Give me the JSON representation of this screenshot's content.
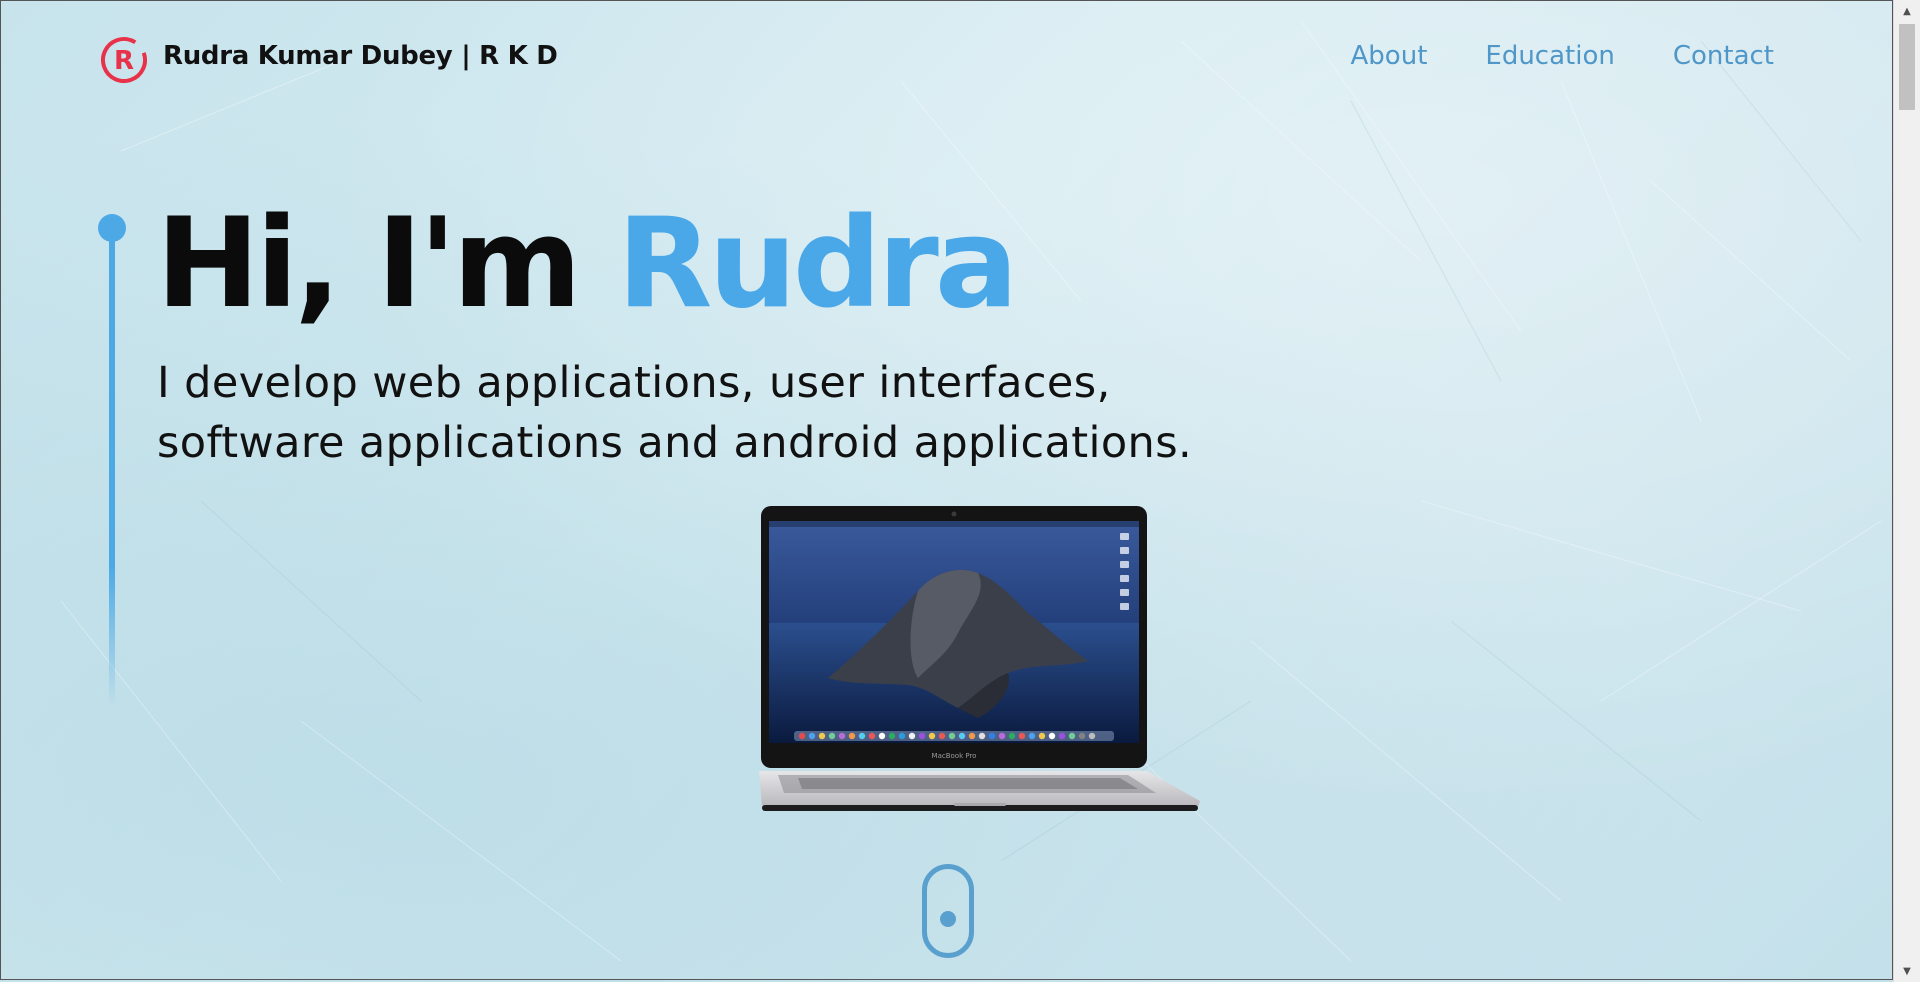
{
  "header": {
    "brand": "Rudra Kumar Dubey  | R K D",
    "logo_icon": "r-letter-logo-icon",
    "logo_color": "#e8324a",
    "nav": [
      {
        "label": "About"
      },
      {
        "label": "Education"
      },
      {
        "label": "Contact"
      }
    ]
  },
  "hero": {
    "greeting": "Hi, I'm ",
    "name": "Rudra",
    "subtitle_line1": "I develop web applications, user interfaces,",
    "subtitle_line2": "software applications and android applications.",
    "accent_color": "#4aa8e8"
  },
  "media": {
    "laptop_icon": "laptop-image",
    "laptop_badge": "MacBook Pro"
  },
  "scroll": {
    "icon": "mouse-scroll-icon"
  },
  "colors": {
    "background": "#cfe6ee",
    "nav_link": "#4f97c8",
    "timeline": "#4ca9e6"
  }
}
